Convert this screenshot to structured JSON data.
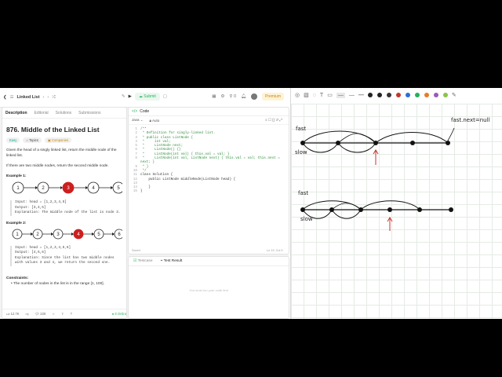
{
  "nav": {
    "problem_list": "Linked List",
    "submit": "Submit",
    "counter": "0",
    "premium": "Premium"
  },
  "tabs": [
    "Description",
    "Editorial",
    "Solutions",
    "Submissions"
  ],
  "problem": {
    "title": "876. Middle of the Linked List",
    "difficulty": "Easy",
    "topics": "Topics",
    "companies": "Companies",
    "statement": "Given the head of a singly linked list, return the middle node of the linked list.",
    "statement2": "If there are two middle nodes, return the second middle node.",
    "example1": {
      "title": "Example 1:",
      "nodes": [
        "1",
        "2",
        "3",
        "4",
        "5"
      ],
      "highlight": 2,
      "input": "Input: head = [1,2,3,4,5]",
      "output": "Output: [3,4,5]",
      "explanation": "Explanation: The middle node of the list is node 3."
    },
    "example2": {
      "title": "Example 2:",
      "nodes": [
        "1",
        "2",
        "3",
        "4",
        "5",
        "6"
      ],
      "highlight": 3,
      "input": "Input: head = [1,2,3,4,5,6]",
      "output": "Output: [4,5,6]",
      "explanation": "Explanation: Since the list has two middle nodes with values 3 and 4, we return the second one."
    },
    "constraints_title": "Constraints:",
    "constraint1": "The number of nodes in the list is in the range [1, 100]."
  },
  "desc_footer": {
    "likes": "12.7K",
    "comments": "220",
    "online": "8 Online"
  },
  "code": {
    "tab": "Code",
    "language": "Java",
    "auto": "Auto",
    "lines": [
      {
        "n": "1",
        "t": "/**",
        "c": true
      },
      {
        "n": "2",
        "t": " * Definition for singly-linked list.",
        "c": true
      },
      {
        "n": "3",
        "t": " * public class ListNode {",
        "c": true
      },
      {
        "n": "4",
        "t": " *     int val;",
        "c": true
      },
      {
        "n": "5",
        "t": " *     ListNode next;",
        "c": true
      },
      {
        "n": "6",
        "t": " *     ListNode() {}",
        "c": true
      },
      {
        "n": "7",
        "t": " *     ListNode(int val) { this.val = val; }",
        "c": true
      },
      {
        "n": "8",
        "t": " *     ListNode(int val, ListNode next) { this.val = val; this.next =",
        "c": true
      },
      {
        "n": "",
        "t": "next; }",
        "c": true
      },
      {
        "n": "9",
        "t": " * }",
        "c": true
      },
      {
        "n": "10",
        "t": " */",
        "c": true
      },
      {
        "n": "11",
        "t": "class Solution {",
        "c": false
      },
      {
        "n": "12",
        "t": "    public ListNode middleNode(ListNode head) {",
        "c": false
      },
      {
        "n": "13",
        "t": "",
        "c": false
      },
      {
        "n": "14",
        "t": "    }",
        "c": false
      },
      {
        "n": "15",
        "t": "}",
        "c": false
      }
    ],
    "saved": "Saved",
    "cursor": "Ln 13, Col 9"
  },
  "test": {
    "testcase": "Testcase",
    "result": "Test Result",
    "empty": "You must run your code first"
  },
  "whiteboard": {
    "fast1": "fast",
    "slow1": "slow",
    "fastnull": "fast.next=null",
    "fast2": "fast",
    "slow2": "slow",
    "colors": [
      "#222222",
      "#222222",
      "#333333",
      "#c0392b",
      "#2c6fd1",
      "#27ae60",
      "#e67e22",
      "#9b59b6",
      "#8bc34a"
    ]
  }
}
